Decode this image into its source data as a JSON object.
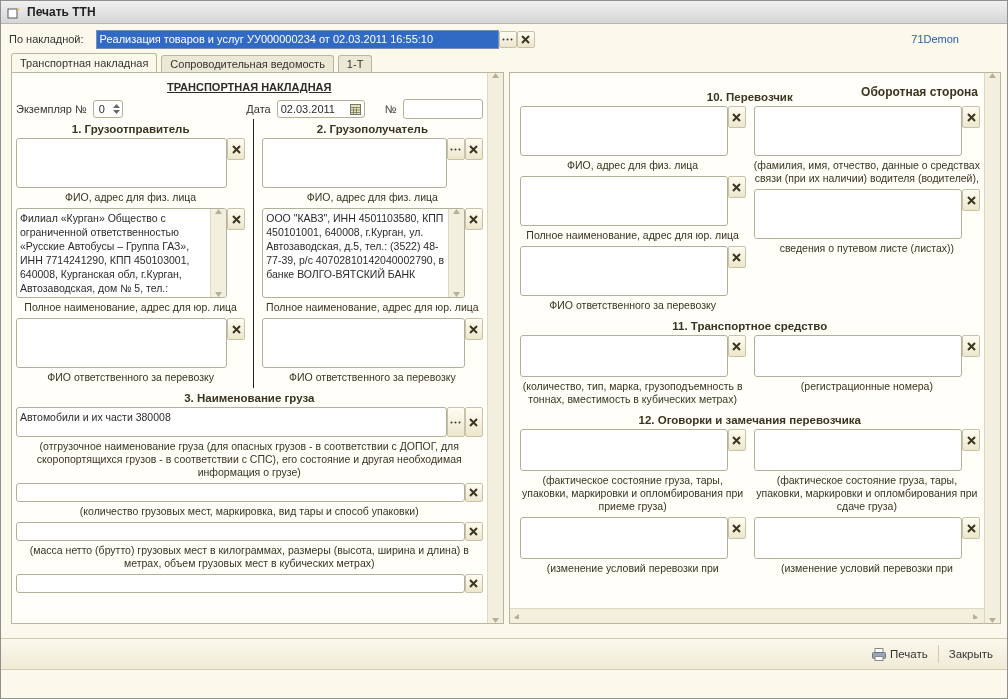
{
  "window": {
    "title": "Печать ТТН"
  },
  "invoice": {
    "label": "По накладной:",
    "value": "Реализация товаров и услуг УУ000000234 от 02.03.2011 16:55:10",
    "highlighted": true,
    "select": true
  },
  "user": "71Demon",
  "tabs": [
    {
      "label": "Транспортная накладная",
      "selected": true
    },
    {
      "label": "Сопроводительная ведомость",
      "selected": false
    },
    {
      "label": "1-Т",
      "selected": false
    }
  ],
  "left_page": {
    "title": "ТРАНСПОРТНАЯ НАКЛАДНАЯ",
    "copy": {
      "label": "Экземпляр №",
      "value": "0"
    },
    "date": {
      "label": "Дата",
      "value": "02.03.2011"
    },
    "number": {
      "label": "№"
    },
    "sections": [
      {
        "divided": true,
        "columns": [
          {
            "heading": "1. Грузоотправитель",
            "fields": [
              {
                "kind": "box",
                "select": false,
                "caption": "ФИО, адрес для физ. лица"
              },
              {
                "kind": "memo",
                "select": false,
                "value": "Филиал «Курган» Общество с ограниченной ответственностью «Русские Автобусы – Группа ГАЗ», ИНН 7714241290, КПП 450103001, 640008, Курганская обл, г.Курган, Автозаводская, дом № 5, тел.:",
                "caption": "Полное наименование, адрес для юр. лица"
              },
              {
                "kind": "box",
                "select": false,
                "caption": "ФИО ответственного за перевозку"
              }
            ]
          },
          {
            "heading": "2. Грузополучатель",
            "fields": [
              {
                "kind": "box",
                "select": true,
                "caption": "ФИО, адрес для физ. лица"
              },
              {
                "kind": "memo",
                "select": false,
                "value": "ООО \"КАВЗ\", ИНН 4501103580, КПП 450101001, 640008, г.Курган, ул. Автозаводская, д.5, тел.: (3522) 48-77-39, р/с 40702810142040002790, в банке ВОЛГО-ВЯТСКИЙ БАНК",
                "caption": "Полное наименование, адрес для юр. лица"
              },
              {
                "kind": "box",
                "select": false,
                "caption": "ФИО ответственного за перевозку"
              }
            ]
          }
        ]
      },
      {
        "heading": "3. Наименование груза",
        "columns": [
          {
            "fields": [
              {
                "kind": "wide",
                "select": true,
                "value": "Автомобили и их части 380008",
                "caption": "(отгрузочное наименование груза (для опасных грузов - в соответствии с ДОПОГ, для скоропортящихся грузов - в соответствии с СПС), его состояние и другая необходимая информация о грузе)"
              },
              {
                "kind": "line",
                "select": false,
                "caption": "(количество грузовых мест, маркировка, вид тары и способ упаковки)"
              },
              {
                "kind": "line",
                "select": false,
                "caption": "(масса нетто (брутто) грузовых мест в килограммах, размеры (высота, ширина и длина) в метрах, объем грузовых мест в кубических метрах)"
              },
              {
                "kind": "line",
                "select": false
              }
            ]
          }
        ]
      }
    ]
  },
  "right_page": {
    "side_title": "Оборотная сторона",
    "sections": [
      {
        "heading": "10. Перевозчик",
        "columns": [
          {
            "fields": [
              {
                "kind": "box",
                "select": false,
                "caption": "ФИО, адрес для физ. лица"
              },
              {
                "kind": "box",
                "select": false,
                "caption": "Полное наименование, адрес для юр. лица"
              },
              {
                "kind": "box",
                "select": false,
                "caption": "ФИО ответственного за перевозку"
              }
            ]
          },
          {
            "fields": [
              {
                "kind": "box",
                "select": false,
                "caption": "(фамилия, имя, отчество, данные о средствах связи (при их наличии) водителя (водителей),"
              },
              {
                "kind": "box",
                "select": false,
                "caption": "сведения о путевом листе (листах))"
              }
            ]
          }
        ]
      },
      {
        "heading": "11. Транспортное средство",
        "columns": [
          {
            "fields": [
              {
                "kind": "short",
                "select": false,
                "caption": "(количество, тип, марка, грузоподъемность в тоннах, вместимость в кубических метрах)"
              }
            ]
          },
          {
            "fields": [
              {
                "kind": "short",
                "select": false,
                "caption": "(регистрационные номера)"
              }
            ]
          }
        ]
      },
      {
        "heading": "12. Оговорки и замечания перевозчика",
        "columns": [
          {
            "fields": [
              {
                "kind": "short",
                "select": false,
                "caption": "(фактическое состояние груза, тары, упаковки, маркировки и опломбирования при приеме груза)"
              },
              {
                "kind": "short",
                "select": false,
                "caption": "(изменение условий перевозки при"
              }
            ]
          },
          {
            "fields": [
              {
                "kind": "short",
                "select": false,
                "caption": "(фактическое состояние груза, тары, упаковки, маркировки и опломбирования при сдаче груза)"
              },
              {
                "kind": "short",
                "select": false,
                "caption": "(изменение условий перевозки при"
              }
            ]
          }
        ]
      }
    ]
  },
  "buttons": [
    {
      "kind": "print",
      "label": "Печать"
    },
    {
      "kind": "close",
      "label": "Закрыть"
    }
  ]
}
